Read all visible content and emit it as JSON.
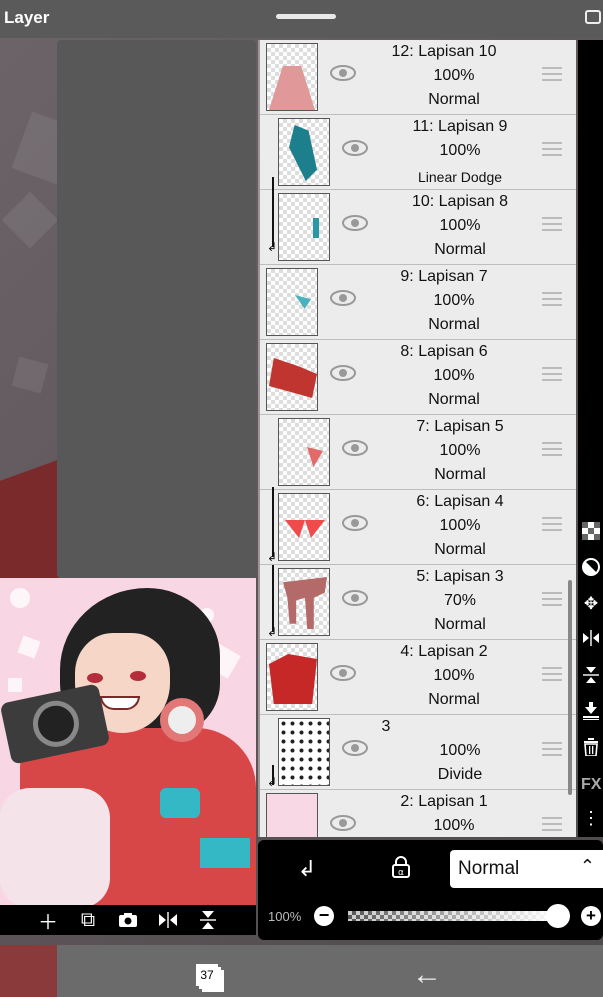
{
  "window": {
    "title": "Layer"
  },
  "layers": [
    {
      "name": "12: Lapisan 10",
      "opacity": "100%",
      "mode": "Normal"
    },
    {
      "name": "11: Lapisan 9",
      "opacity": "100%",
      "mode": "Linear Dodge"
    },
    {
      "name": "10: Lapisan 8",
      "opacity": "100%",
      "mode": "Normal"
    },
    {
      "name": "9: Lapisan 7",
      "opacity": "100%",
      "mode": "Normal"
    },
    {
      "name": "8: Lapisan 6",
      "opacity": "100%",
      "mode": "Normal"
    },
    {
      "name": "7: Lapisan 5",
      "opacity": "100%",
      "mode": "Normal"
    },
    {
      "name": "6: Lapisan 4",
      "opacity": "100%",
      "mode": "Normal"
    },
    {
      "name": "5: Lapisan 3",
      "opacity": "70%",
      "mode": "Normal"
    },
    {
      "name": "4: Lapisan 2",
      "opacity": "100%",
      "mode": "Normal"
    },
    {
      "name": "3",
      "opacity": "100%",
      "mode": "Divide"
    },
    {
      "name": "2: Lapisan 1",
      "opacity": "100%",
      "mode": ""
    }
  ],
  "layer_controls": {
    "blend_mode": "Normal",
    "opacity_label": "100%",
    "opacity_value": 1.0
  },
  "bottom": {
    "layer_count": "37"
  },
  "colors": {
    "accent": "#000000",
    "panel": "#e4e4e4",
    "preview_bg": "#f9d6e3"
  }
}
